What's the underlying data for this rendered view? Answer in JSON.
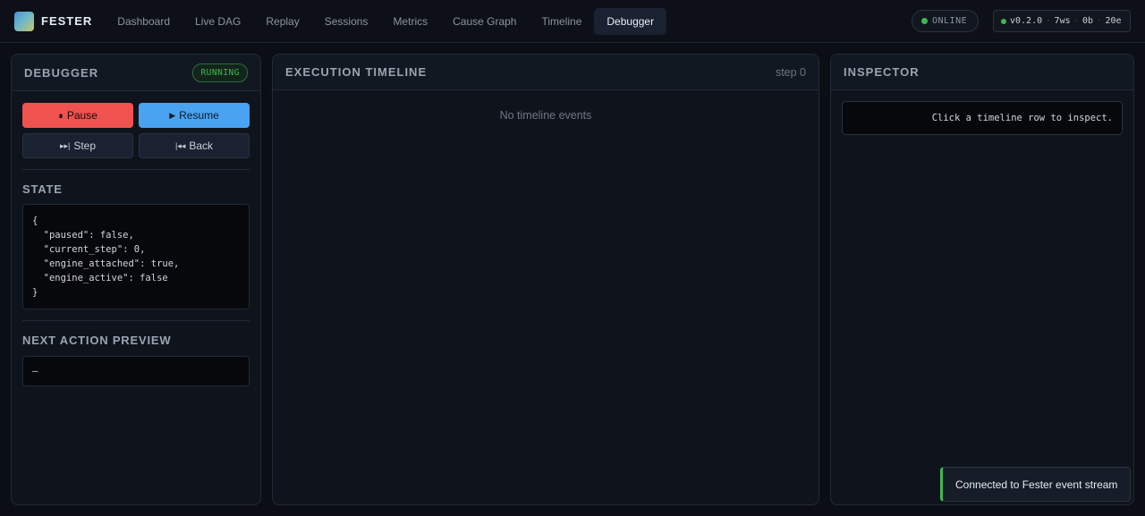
{
  "brand": {
    "name": "FESTER"
  },
  "nav": {
    "items": [
      "Dashboard",
      "Live DAG",
      "Replay",
      "Sessions",
      "Metrics",
      "Cause Graph",
      "Timeline",
      "Debugger"
    ],
    "active": "Debugger"
  },
  "status": {
    "label": "ONLINE",
    "color": "#3fb950"
  },
  "version_info": {
    "version": "v0.2.0",
    "ws": "7ws",
    "bytes": "0b",
    "events": "20e"
  },
  "debugger": {
    "title": "DEBUGGER",
    "badge": "RUNNING",
    "buttons": {
      "pause": "Pause",
      "resume": "Resume",
      "step": "Step",
      "back": "Back"
    },
    "state_title": "STATE",
    "state_json": "{\n  \"paused\": false,\n  \"current_step\": 0,\n  \"engine_attached\": true,\n  \"engine_active\": false\n}",
    "next_action_title": "NEXT ACTION PREVIEW",
    "next_action": "—"
  },
  "timeline": {
    "title": "EXECUTION TIMELINE",
    "step_label": "step 0",
    "empty_message": "No timeline events"
  },
  "inspector": {
    "title": "INSPECTOR",
    "placeholder": "Click a timeline row to inspect."
  },
  "toast": {
    "message": "Connected to Fester event stream"
  },
  "colors": {
    "pause": "#f0524f",
    "resume": "#4aa3f0",
    "accent_green": "#3fb950",
    "background": "#0b0e14"
  }
}
